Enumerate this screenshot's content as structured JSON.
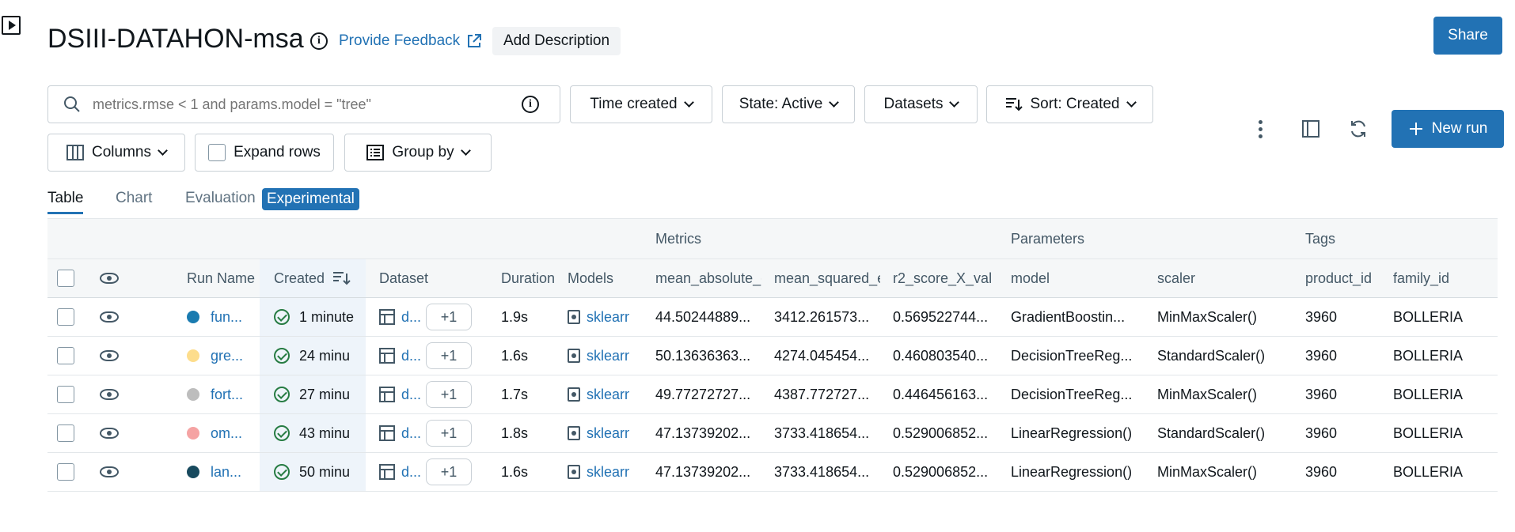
{
  "header": {
    "title": "DSIII-DATAHON-msa",
    "feedback_label": "Provide Feedback",
    "add_description_label": "Add Description",
    "share_label": "Share"
  },
  "toolbar": {
    "search_placeholder": "metrics.rmse < 1 and params.model = \"tree\"",
    "time_created_label": "Time created",
    "state_label": "State: Active",
    "datasets_label": "Datasets",
    "sort_label": "Sort: Created",
    "columns_label": "Columns",
    "expand_rows_label": "Expand rows",
    "group_by_label": "Group by",
    "new_run_label": "New run"
  },
  "tabs": [
    {
      "label": "Table",
      "active": true
    },
    {
      "label": "Chart",
      "active": false
    },
    {
      "label": "Evaluation",
      "active": false
    },
    {
      "label": "Experimental",
      "active": false
    }
  ],
  "table": {
    "groups": {
      "metrics": "Metrics",
      "parameters": "Parameters",
      "tags": "Tags"
    },
    "columns": [
      "Run Name",
      "Created",
      "Dataset",
      "Duration",
      "Models",
      "mean_absolute_e",
      "mean_squared_e",
      "r2_score_X_val",
      "model",
      "scaler",
      "product_id",
      "family_id"
    ],
    "rows": [
      {
        "color": "#1a7bb0",
        "run_name": "fun...",
        "created": "1 minute",
        "dataset": "d...",
        "dataset_more": "+1",
        "duration": "1.9s",
        "model_link": "sklearn",
        "mae": "44.50244889...",
        "mse": "3412.261573...",
        "r2": "0.569522744...",
        "model": "GradientBoostin...",
        "scaler": "MinMaxScaler()",
        "product_id": "3960",
        "family_id": "BOLLERIA"
      },
      {
        "color": "#fddd8c",
        "run_name": "gre...",
        "created": "24 minu",
        "dataset": "d...",
        "dataset_more": "+1",
        "duration": "1.6s",
        "model_link": "sklearn",
        "mae": "50.13636363...",
        "mse": "4274.045454...",
        "r2": "0.460803540...",
        "model": "DecisionTreeReg...",
        "scaler": "StandardScaler()",
        "product_id": "3960",
        "family_id": "BOLLERIA"
      },
      {
        "color": "#bdbdbd",
        "run_name": "fort...",
        "created": "27 minu",
        "dataset": "d...",
        "dataset_more": "+1",
        "duration": "1.7s",
        "model_link": "sklearn",
        "mae": "49.77272727...",
        "mse": "4387.772727...",
        "r2": "0.446456163...",
        "model": "DecisionTreeReg...",
        "scaler": "MinMaxScaler()",
        "product_id": "3960",
        "family_id": "BOLLERIA"
      },
      {
        "color": "#f5a3a3",
        "run_name": "om...",
        "created": "43 minu",
        "dataset": "d...",
        "dataset_more": "+1",
        "duration": "1.8s",
        "model_link": "sklearn",
        "mae": "47.13739202...",
        "mse": "3733.418654...",
        "r2": "0.529006852...",
        "model": "LinearRegression()",
        "scaler": "StandardScaler()",
        "product_id": "3960",
        "family_id": "BOLLERIA"
      },
      {
        "color": "#184a5e",
        "run_name": "lan...",
        "created": "50 minu",
        "dataset": "d...",
        "dataset_more": "+1",
        "duration": "1.6s",
        "model_link": "sklearn",
        "mae": "47.13739202...",
        "mse": "3733.418654...",
        "r2": "0.529006852...",
        "model": "LinearRegression()",
        "scaler": "MinMaxScaler()",
        "product_id": "3960",
        "family_id": "BOLLERIA"
      }
    ]
  },
  "colors": {
    "accent": "#2272b4",
    "success": "#277c43"
  }
}
